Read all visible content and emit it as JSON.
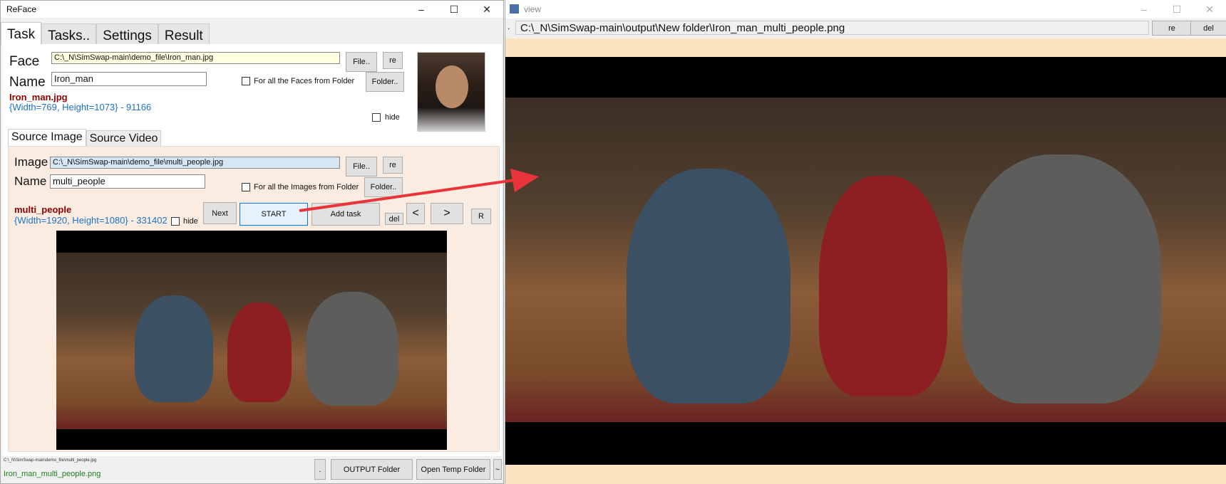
{
  "left_window": {
    "title": "ReFace",
    "controls": {
      "minimize": "–",
      "maximize": "☐",
      "close": "✕"
    },
    "tabs": [
      "Task",
      "Tasks..",
      "Settings",
      "Result"
    ],
    "face": {
      "label": "Face",
      "path": "C:\\_N\\SimSwap-main\\demo_file\\Iron_man.jpg",
      "file_button": "File..",
      "re_button": "re",
      "name_label": "Name",
      "name_value": "Iron_man",
      "folder_checkbox_label": "For all the Faces from Folder",
      "folder_button": "Folder..",
      "filename": "Iron_man.jpg",
      "info": "{Width=769, Height=1073} - 91166",
      "hide_label": "hide"
    },
    "source_tabs": [
      "Source Image",
      "Source Video"
    ],
    "source": {
      "image_label": "Image",
      "path": "C:\\_N\\SimSwap-main\\demo_file\\multi_people.jpg",
      "file_button": "File..",
      "re_button": "re",
      "name_label": "Name",
      "name_value": "multi_people",
      "folder_checkbox_label": "For all the Images from Folder",
      "folder_button": "Folder..",
      "filename": "multi_people",
      "info": "{Width=1920, Height=1080} - 331402",
      "hide_label": "hide",
      "next_button": "Next",
      "start_button": "START",
      "add_task_button": "Add task",
      "del_button": "del",
      "prev_arrow": "<",
      "next_arrow": ">",
      "r_button": "R"
    },
    "bottom": {
      "status_path": "C:\\_N\\SimSwap-main\\demo_file\\multi_people.jpg",
      "result_file": "Iron_man_multi_people.png",
      "dot_button": ".",
      "output_folder_button": "OUTPUT Folder",
      "temp_folder_button": "Open Temp Folder",
      "tilde_button": "~"
    }
  },
  "right_window": {
    "title": "view",
    "controls": {
      "minimize": "–",
      "maximize": "☐",
      "close": "✕"
    },
    "dot": ".",
    "path": "C:\\_N\\SimSwap-main\\output\\New folder\\Iron_man_multi_people.png",
    "re_button": "re",
    "del_button": "del"
  },
  "colors": {
    "source_panel_bg": "#faece1",
    "view_bg": "#fde3c0",
    "start_border": "#0078d7",
    "arrow": "#e8343a"
  }
}
